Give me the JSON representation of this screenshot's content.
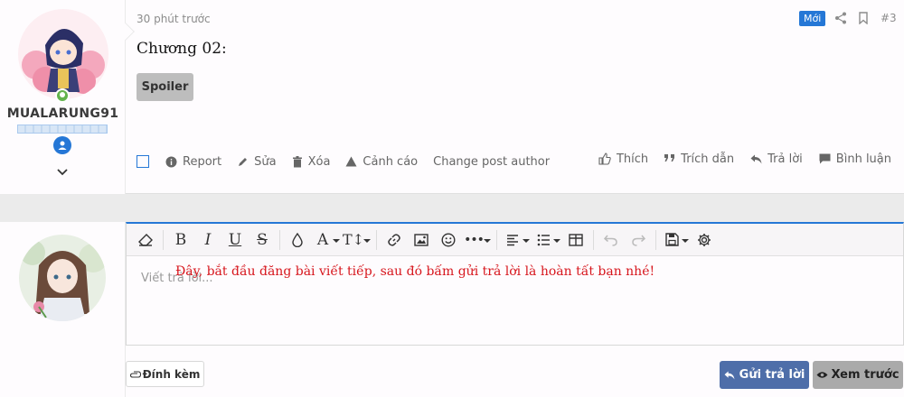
{
  "post": {
    "time": "30 phút trước",
    "badge_new": "Mới",
    "post_number": "#3",
    "title": "Chương 02:",
    "spoiler_label": "Spoiler",
    "user": {
      "name": "MUALARUNG91"
    },
    "actions": {
      "report": "Report",
      "edit": "Sửa",
      "delete": "Xóa",
      "warn": "Cảnh cáo",
      "change_author": "Change post author",
      "like": "Thích",
      "quote": "Trích dẫn",
      "reply": "Trả lời",
      "comment": "Bình luận"
    }
  },
  "editor": {
    "placeholder": "Viết trả lời...",
    "hint": "Đây, bắt đầu đăng bài viết tiếp, sau đó bấm gửi trả lời là hoàn tất bạn nhé!",
    "attach_label": "Đính kèm",
    "submit_label": "Gửi trả lời",
    "preview_label": "Xem trước"
  },
  "colors": {
    "accent": "#2577d6",
    "hint": "#d7161d",
    "submit": "#4e6ea9"
  }
}
